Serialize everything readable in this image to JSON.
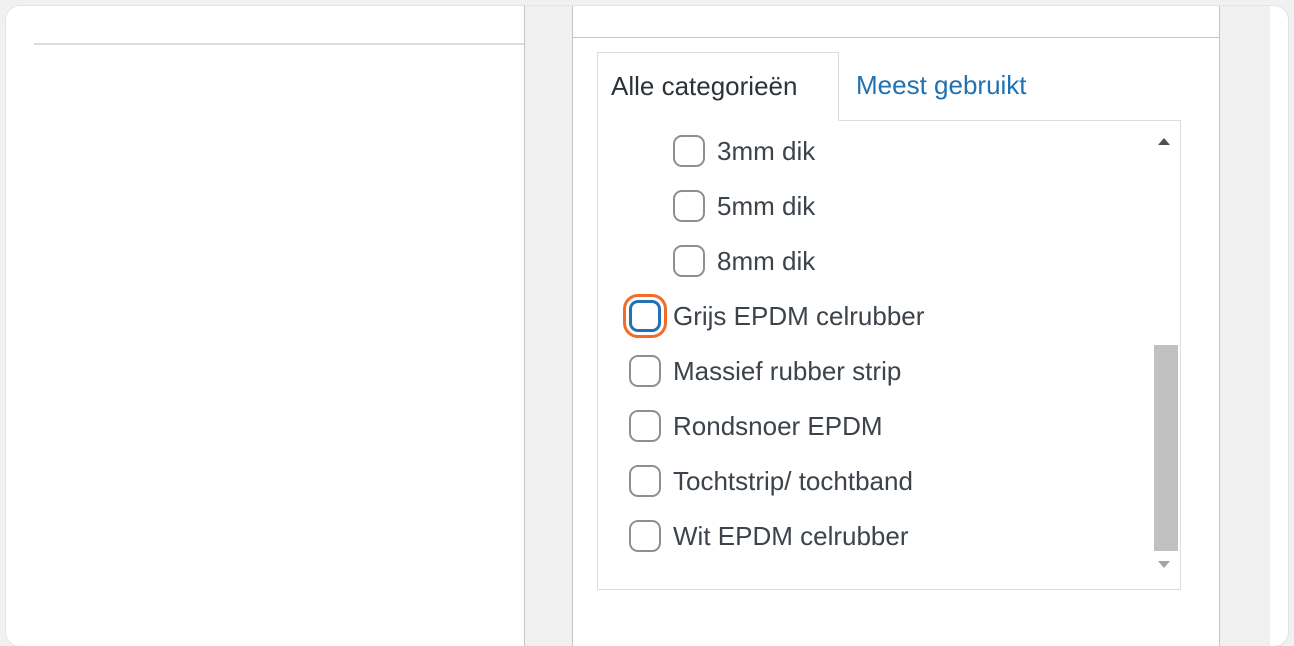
{
  "tabs": {
    "all": "Alle categorieën",
    "popular": "Meest gebruikt"
  },
  "categories": [
    {
      "label": "3mm dik",
      "checked": false,
      "level": 1
    },
    {
      "label": "5mm dik",
      "checked": false,
      "level": 1
    },
    {
      "label": "8mm dik",
      "checked": false,
      "level": 1
    },
    {
      "label": "Grijs EPDM celrubber",
      "checked": false,
      "level": 0,
      "focused": true
    },
    {
      "label": "Massief rubber strip",
      "checked": false,
      "level": 0
    },
    {
      "label": "Rondsnoer EPDM",
      "checked": false,
      "level": 0
    },
    {
      "label": "Tochtstrip/ tochtband",
      "checked": false,
      "level": 0
    },
    {
      "label": "Wit EPDM celrubber",
      "checked": false,
      "level": 0
    }
  ],
  "colors": {
    "link": "#2271b1",
    "focus_ring": "#f26b2a",
    "checkbox_border": "#8c8f94",
    "text": "#3c434a"
  }
}
